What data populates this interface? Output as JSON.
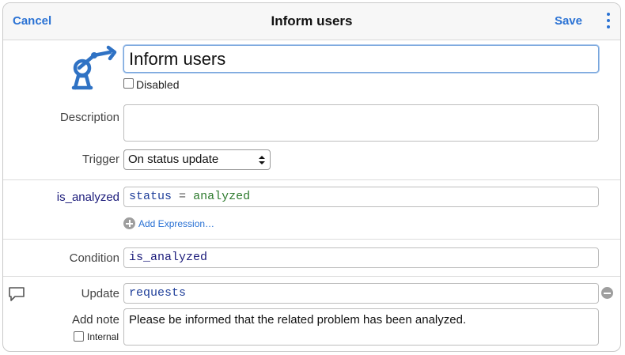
{
  "header": {
    "cancel_label": "Cancel",
    "title": "Inform users",
    "save_label": "Save",
    "more_icon": "more-vertical-icon"
  },
  "form": {
    "name_value": "Inform users",
    "disabled_label": "Disabled",
    "disabled_checked": false,
    "description_label": "Description",
    "description_value": "",
    "trigger_label": "Trigger",
    "trigger_value": "On status update"
  },
  "expressions": [
    {
      "name": "is_analyzed",
      "lhs": "status",
      "op": "=",
      "rhs": "analyzed"
    }
  ],
  "add_expression_label": "Add Expression…",
  "condition": {
    "label": "Condition",
    "value": "is_analyzed"
  },
  "update": {
    "label": "Update",
    "value": "requests"
  },
  "note": {
    "label": "Add note",
    "internal_label": "Internal",
    "internal_checked": false,
    "value": "Please be informed that the related problem has been analyzed."
  },
  "colors": {
    "accent": "#2a72d4",
    "icon_blue": "#2f72c4",
    "identifier": "#1a1a7a",
    "value_green": "#2d7a2d"
  }
}
